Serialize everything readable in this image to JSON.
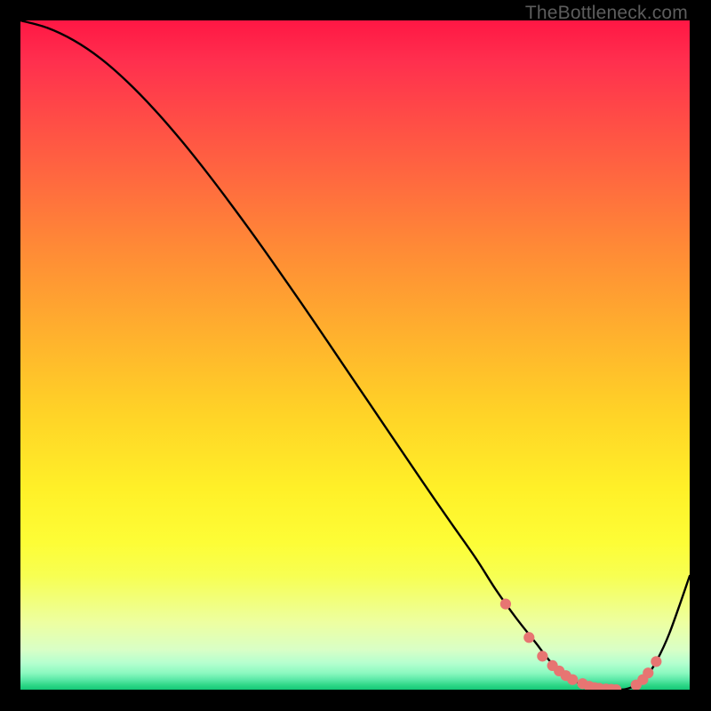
{
  "watermark": "TheBottleneck.com",
  "colors": {
    "curve_stroke": "#000000",
    "marker_fill": "#e77572",
    "marker_stroke": "#e77572"
  },
  "chart_data": {
    "type": "line",
    "title": "",
    "xlabel": "",
    "ylabel": "",
    "xlim": [
      0,
      100
    ],
    "ylim": [
      0,
      100
    ],
    "series": [
      {
        "name": "bottleneck-curve",
        "x": [
          0,
          4,
          8,
          12,
          16,
          20,
          24,
          28,
          32,
          36,
          40,
          44,
          48,
          52,
          56,
          60,
          64,
          68,
          71,
          74,
          77,
          79,
          81,
          83,
          85,
          87,
          89,
          90.5,
          92,
          93.5,
          95,
          97,
          100
        ],
        "y": [
          100,
          98.9,
          97.0,
          94.3,
          90.8,
          86.7,
          82.1,
          77.1,
          71.8,
          66.3,
          60.6,
          54.8,
          48.9,
          43.0,
          37.1,
          31.2,
          25.4,
          19.7,
          15.0,
          10.8,
          7.0,
          4.4,
          2.5,
          1.2,
          0.5,
          0.1,
          0.0,
          0.1,
          0.7,
          2.0,
          4.2,
          8.5,
          17.0
        ]
      }
    ],
    "markers": {
      "name": "highlight-points",
      "x": [
        72.5,
        76.0,
        78.0,
        79.5,
        80.5,
        81.5,
        82.5,
        84.0,
        85.0,
        85.8,
        86.5,
        87.5,
        88.3,
        89.0,
        92.0,
        93.0,
        93.8,
        95.0
      ],
      "y": [
        12.8,
        7.8,
        5.0,
        3.6,
        2.8,
        2.1,
        1.5,
        0.9,
        0.5,
        0.3,
        0.2,
        0.1,
        0.05,
        0.0,
        0.7,
        1.5,
        2.5,
        4.2
      ]
    }
  }
}
